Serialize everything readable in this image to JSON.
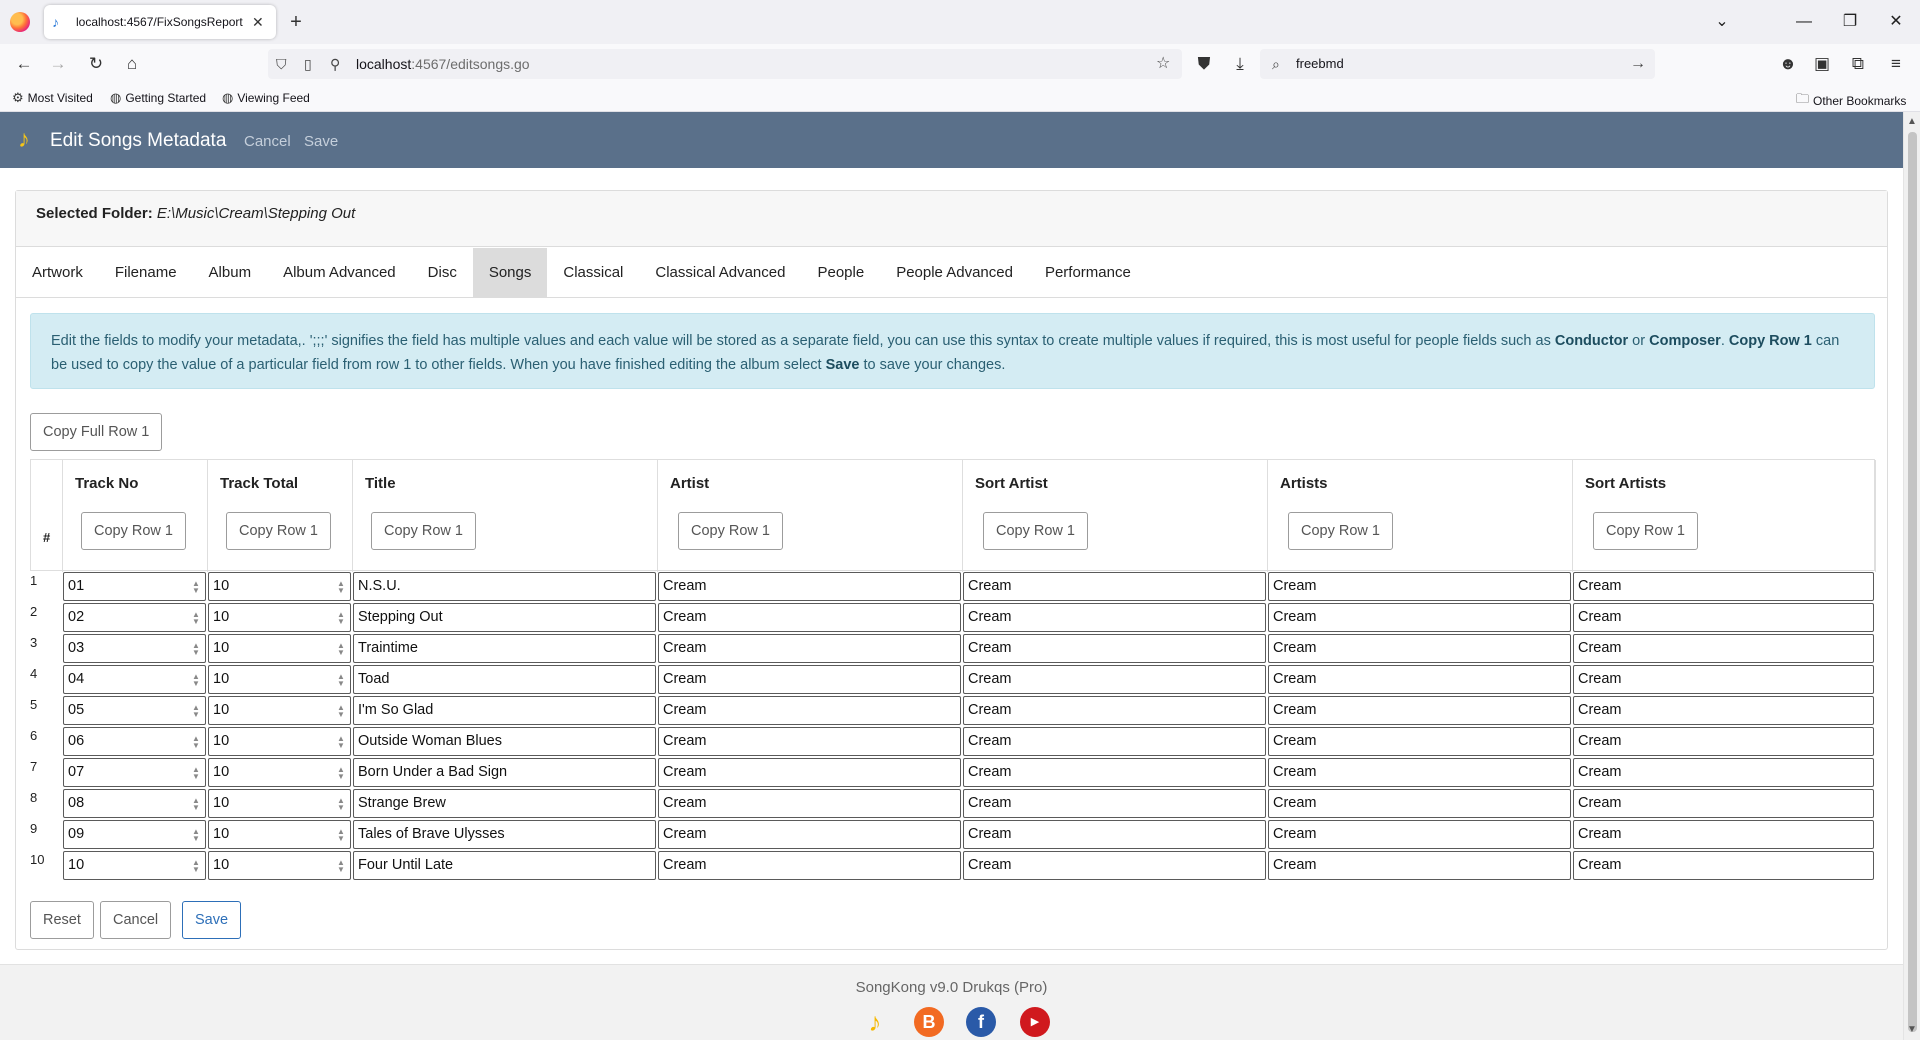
{
  "browser": {
    "tab_title": "localhost:4567/FixSongsReport",
    "url_host": "localhost",
    "url_rest": ":4567/editsongs.go",
    "search_value": "freebmd",
    "bookmarks": [
      "Most Visited",
      "Getting Started",
      "Viewing Feed"
    ],
    "other_bookmarks": "Other Bookmarks"
  },
  "header": {
    "title": "Edit Songs Metadata",
    "cancel_label": "Cancel",
    "save_label": "Save"
  },
  "folder": {
    "label": "Selected Folder:",
    "path": "E:\\Music\\Cream\\Stepping Out"
  },
  "tabs": [
    "Artwork",
    "Filename",
    "Album",
    "Album Advanced",
    "Disc",
    "Songs",
    "Classical",
    "Classical Advanced",
    "People",
    "People Advanced",
    "Performance"
  ],
  "active_tab": "Songs",
  "info": {
    "p1": "Edit the fields to modify your metadata,. ';;;' signifies the field has multiple values and each value will be stored as a separate field, you can use this syntax to create multiple values if required, this is most useful for people fields such as ",
    "conductor": "Conductor",
    "or": " or ",
    "composer": "Composer",
    "dot": ". ",
    "copy_row": "Copy Row 1",
    "p2": " can be used to copy the value of a particular field from row 1 to other fields. When you have finished editing the album select ",
    "save": "Save",
    "p3": " to save your changes."
  },
  "copy_full_row_label": "Copy Full Row 1",
  "table": {
    "hash": "#",
    "copy_label": "Copy Row 1",
    "columns": [
      "Track No",
      "Track Total",
      "Title",
      "Artist",
      "Sort Artist",
      "Artists",
      "Sort Artists"
    ],
    "rows": [
      {
        "n": "1",
        "track": "01",
        "total": "10",
        "title": "N.S.U.",
        "artist": "Cream",
        "sort_artist": "Cream",
        "artists": "Cream",
        "sort_artists": "Cream"
      },
      {
        "n": "2",
        "track": "02",
        "total": "10",
        "title": "Stepping Out",
        "artist": "Cream",
        "sort_artist": "Cream",
        "artists": "Cream",
        "sort_artists": "Cream"
      },
      {
        "n": "3",
        "track": "03",
        "total": "10",
        "title": "Traintime",
        "artist": "Cream",
        "sort_artist": "Cream",
        "artists": "Cream",
        "sort_artists": "Cream"
      },
      {
        "n": "4",
        "track": "04",
        "total": "10",
        "title": "Toad",
        "artist": "Cream",
        "sort_artist": "Cream",
        "artists": "Cream",
        "sort_artists": "Cream"
      },
      {
        "n": "5",
        "track": "05",
        "total": "10",
        "title": "I'm So Glad",
        "artist": "Cream",
        "sort_artist": "Cream",
        "artists": "Cream",
        "sort_artists": "Cream"
      },
      {
        "n": "6",
        "track": "06",
        "total": "10",
        "title": "Outside Woman Blues",
        "artist": "Cream",
        "sort_artist": "Cream",
        "artists": "Cream",
        "sort_artists": "Cream"
      },
      {
        "n": "7",
        "track": "07",
        "total": "10",
        "title": "Born Under a Bad Sign",
        "artist": "Cream",
        "sort_artist": "Cream",
        "artists": "Cream",
        "sort_artists": "Cream"
      },
      {
        "n": "8",
        "track": "08",
        "total": "10",
        "title": "Strange Brew",
        "artist": "Cream",
        "sort_artist": "Cream",
        "artists": "Cream",
        "sort_artists": "Cream"
      },
      {
        "n": "9",
        "track": "09",
        "total": "10",
        "title": "Tales of Brave Ulysses",
        "artist": "Cream",
        "sort_artist": "Cream",
        "artists": "Cream",
        "sort_artists": "Cream"
      },
      {
        "n": "10",
        "track": "10",
        "total": "10",
        "title": "Four Until Late",
        "artist": "Cream",
        "sort_artist": "Cream",
        "artists": "Cream",
        "sort_artists": "Cream"
      }
    ]
  },
  "actions": {
    "reset": "Reset",
    "cancel": "Cancel",
    "save": "Save"
  },
  "footer": {
    "text": "SongKong v9.0 Drukqs (Pro)",
    "icons": [
      "songkong-icon",
      "blogger-icon",
      "facebook-icon",
      "youtube-icon"
    ]
  },
  "colors": {
    "header_bg": "#5a708a",
    "alert_bg": "#d4ecf3",
    "active_tab_bg": "#dcdcdc",
    "primary": "#2d6fb8"
  }
}
